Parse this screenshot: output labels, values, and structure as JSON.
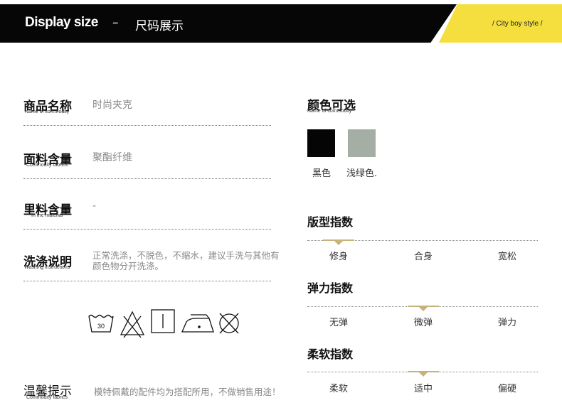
{
  "header": {
    "title": "Display size",
    "dash": "–",
    "subtitle": "尺码展示",
    "tag": "/ City boy style /"
  },
  "info_rows": [
    {
      "label": "商品名称",
      "label_en": "Name of commodity",
      "value": "时尚夹克"
    },
    {
      "label": "面料含量",
      "label_en": "Commodity fabrics",
      "value": "聚酯纤维"
    },
    {
      "label": "里料含量",
      "label_en": "In the material",
      "value": "-"
    },
    {
      "label": "洗涤说明",
      "label_en": "Washing instructions",
      "value": "正常洗涤，不脱色，不缩水，建议手洗与其他有颜色物分开洗涤。"
    }
  ],
  "care_icons": {
    "items": [
      "wash-30-icon",
      "no-bleach-icon",
      "tumble-dry-icon",
      "iron-icon",
      "no-dry-clean-icon"
    ],
    "wash_temp": "30"
  },
  "notice": {
    "label": "温馨提示",
    "label_en": "Commodity fabrics",
    "value": "模特佩戴的配件均为搭配所用，不做销售用途！"
  },
  "colors": {
    "title": "颜色可选",
    "title_en": "Name of commodity",
    "swatches": [
      {
        "name": "黑色",
        "hex": "#050505"
      },
      {
        "name": "浅绿色.",
        "hex": "#a5aea5"
      }
    ]
  },
  "scales": [
    {
      "title": "版型指数",
      "options": [
        "修身",
        "合身",
        "宽松"
      ],
      "selected": 0
    },
    {
      "title": "弹力指数",
      "options": [
        "无弹",
        "微弹",
        "弹力"
      ],
      "selected": 1
    },
    {
      "title": "柔软指数",
      "options": [
        "柔软",
        "适中",
        "偏硬"
      ],
      "selected": 1
    }
  ],
  "accent_color": "#f5df3f",
  "marker_color": "#c8b27a"
}
